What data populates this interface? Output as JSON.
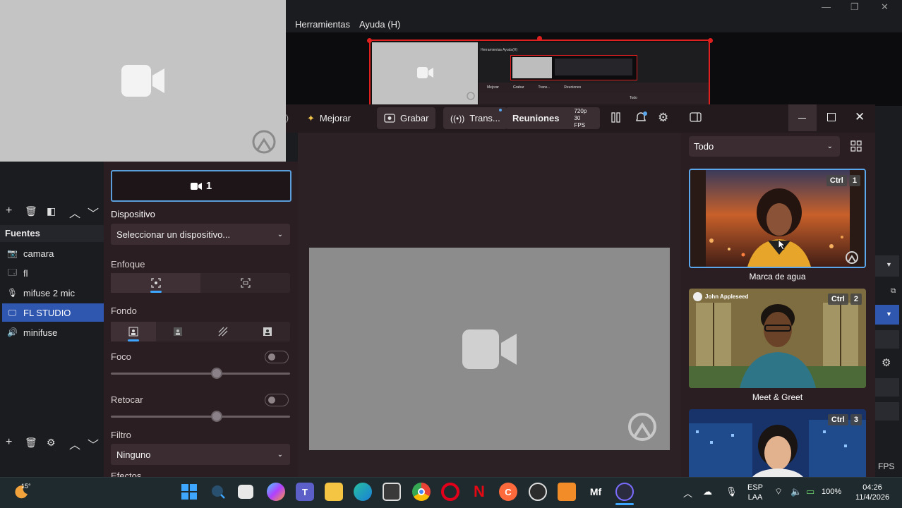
{
  "obs": {
    "menu": [
      "Herramientas",
      "Ayuda (H)"
    ],
    "window_controls": [
      "—",
      "❐",
      "✕"
    ],
    "sources_title": "Fuentes",
    "sources": [
      {
        "label": "camara",
        "icon": "camera-icon",
        "selected": false
      },
      {
        "label": "fl",
        "icon": "window-icon",
        "selected": false
      },
      {
        "label": "mifuse 2 mic",
        "icon": "microphone-icon",
        "selected": false
      },
      {
        "label": "FL STUDIO",
        "icon": "monitor-icon",
        "selected": true
      },
      {
        "label": "minifuse",
        "icon": "speaker-icon",
        "selected": false
      }
    ],
    "fps_fragment": "FPS"
  },
  "camera_panel": {
    "tab_label": "1",
    "dispositivo_label": "Dispositivo",
    "dispositivo_value": "Seleccionar un dispositivo...",
    "enfoque_label": "Enfoque",
    "fondo_label": "Fondo",
    "foco_label": "Foco",
    "foco_value": 0.59,
    "retocar_label": "Retocar",
    "retocar_value": 0.59,
    "filtro_label": "Filtro",
    "filtro_value": "Ninguno",
    "efectos_label": "Efectos"
  },
  "studio": {
    "toolbar": {
      "mejorar": "Mejorar",
      "grabar": "Grabar",
      "trans": "Trans...",
      "reuniones": "Reuniones",
      "resolution": "720p",
      "fps": "30 FPS"
    },
    "filter_value": "Todo",
    "scenes": [
      {
        "label": "Marca de agua",
        "ctrl": "Ctrl",
        "num": "1",
        "selected": true
      },
      {
        "label": "Meet & Greet",
        "ctrl": "Ctrl",
        "num": "2",
        "selected": false,
        "overlay_name": "John Appleseed"
      },
      {
        "label": "",
        "ctrl": "Ctrl",
        "num": "3",
        "selected": false
      }
    ]
  },
  "nested_preview": {
    "menu_text": "Herramientas  Ayuda(H)",
    "toolbar": [
      "Mejorar",
      "Grabar",
      "Trans...",
      "Reuniones"
    ],
    "filter": "Todo"
  },
  "taskbar": {
    "weather": "15°",
    "lang_top": "ESP",
    "lang_bottom": "LAA",
    "battery": "100%",
    "time": "04:26",
    "date": "11/4/2026"
  }
}
